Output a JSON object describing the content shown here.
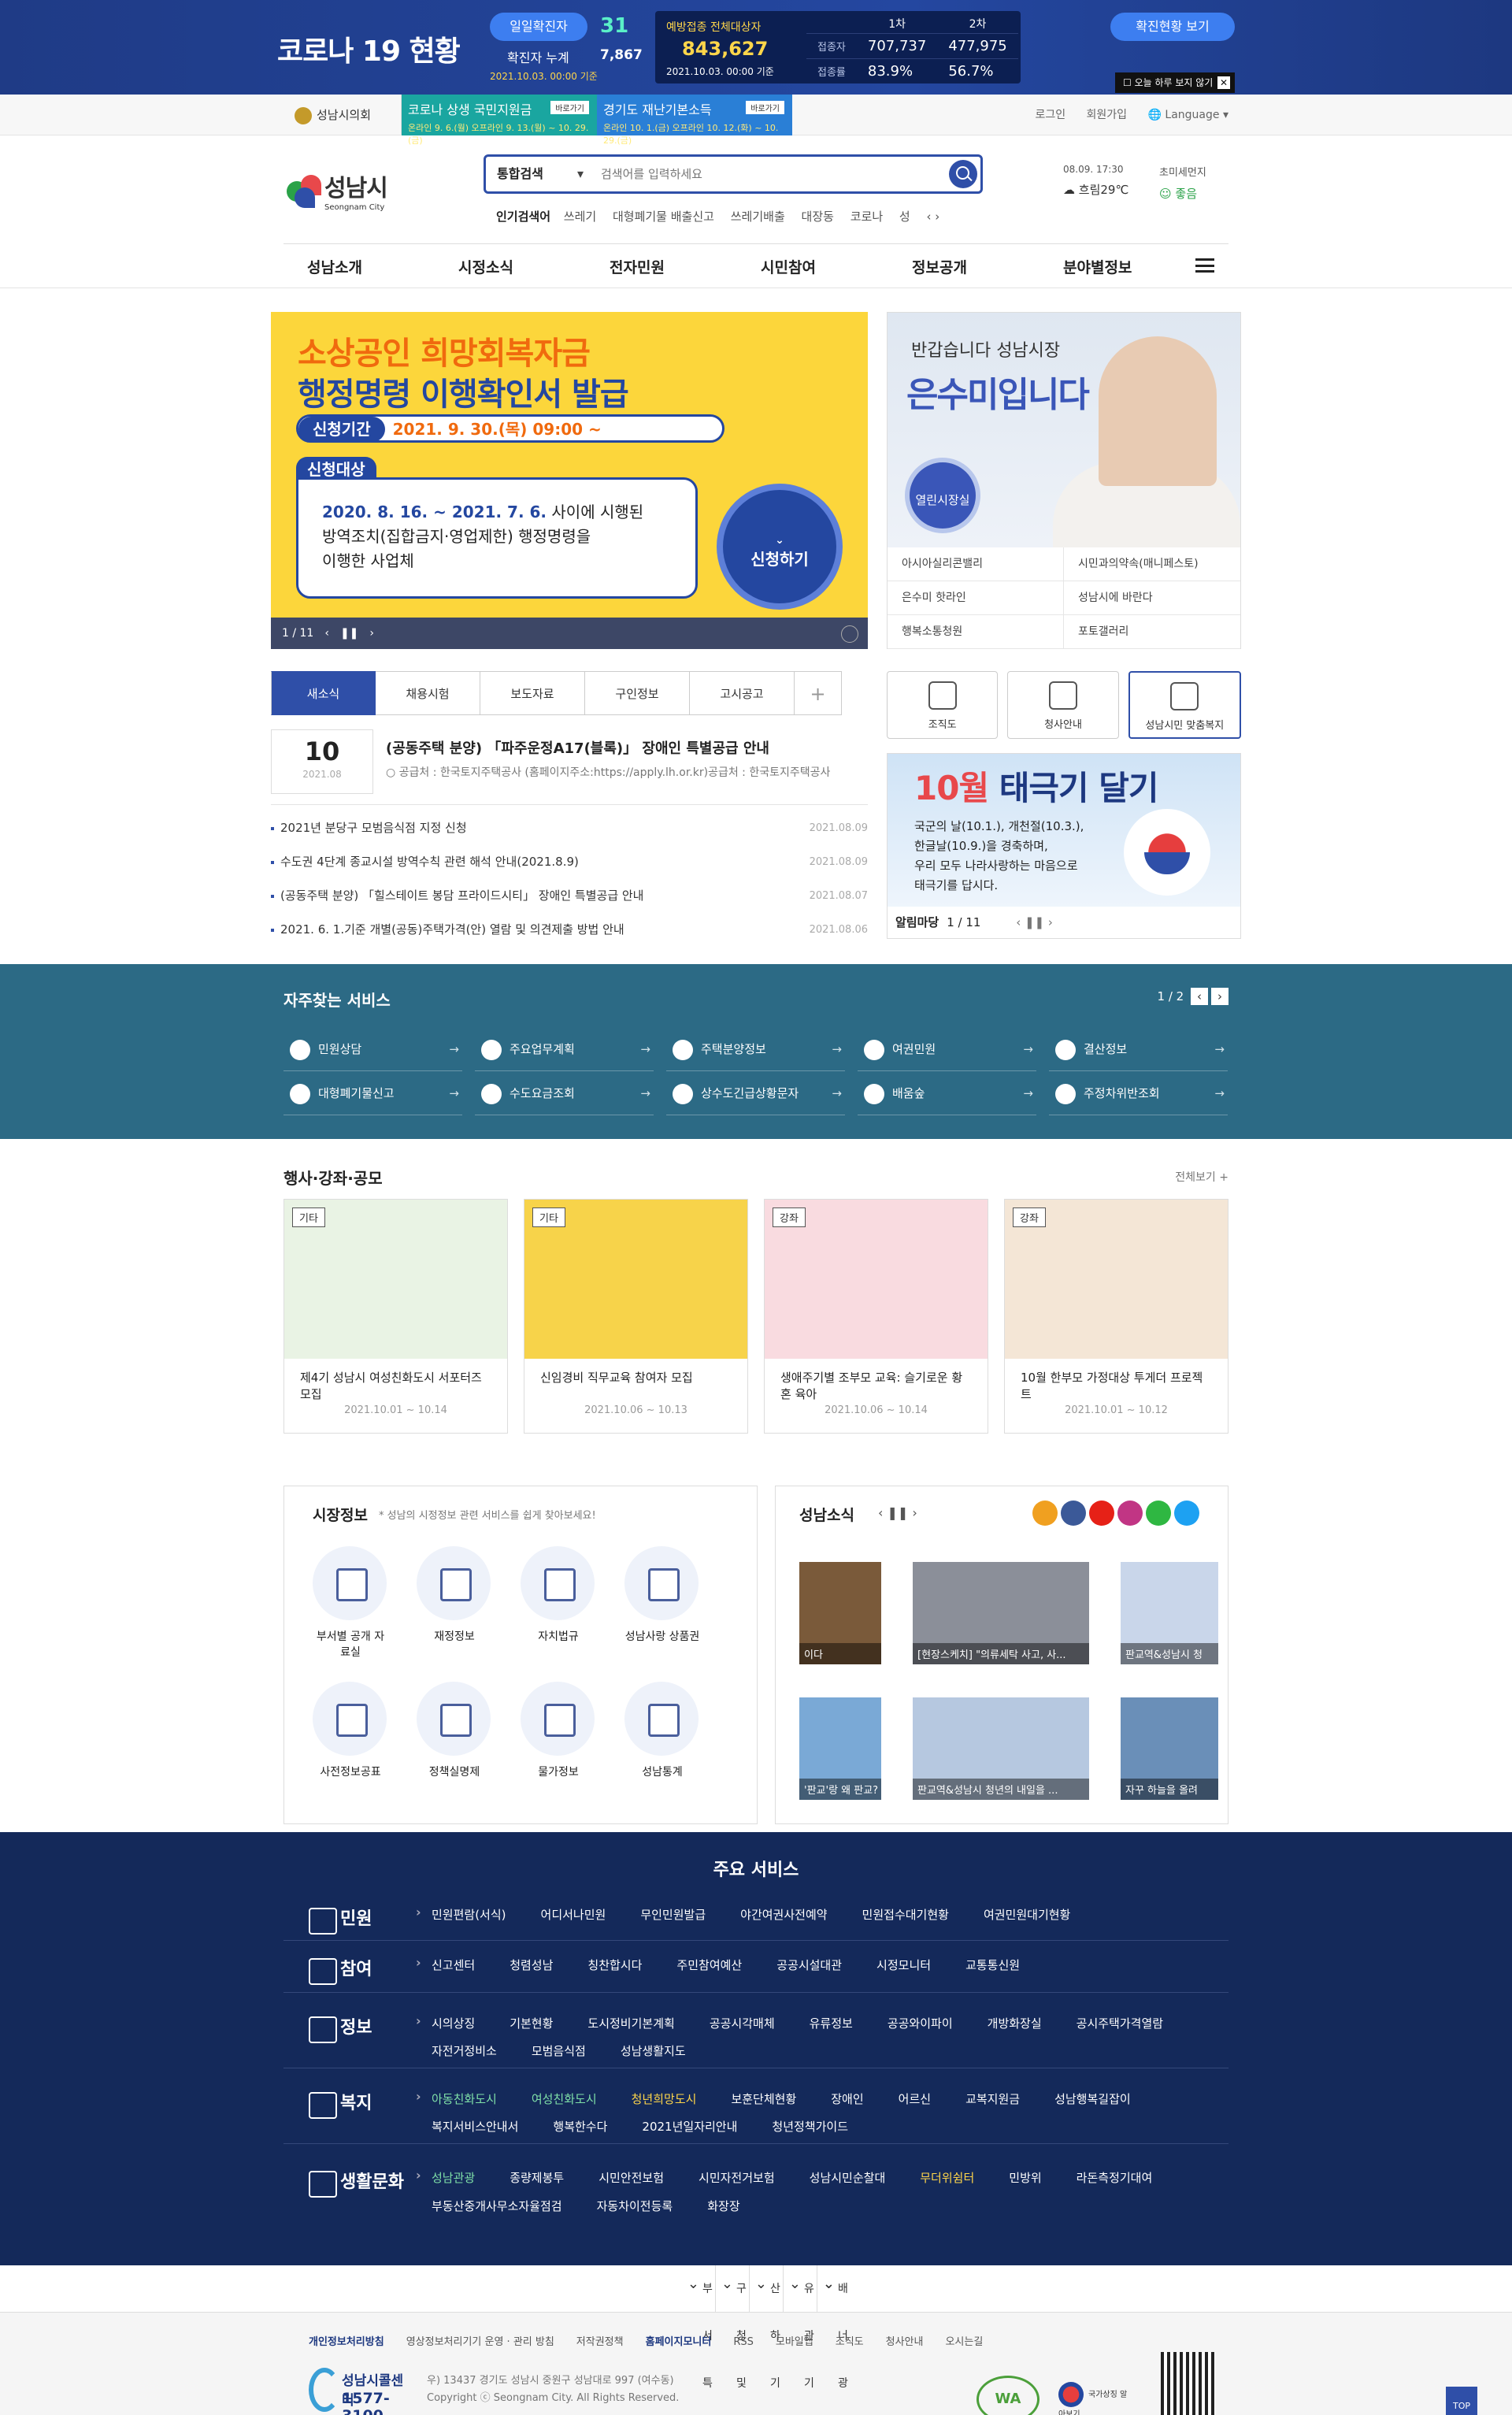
{
  "covid": {
    "title": "코로나 19 현황",
    "daily_label": "일일확진자",
    "daily_value": "31",
    "cum_label": "확진자 누계",
    "cum_value": "7,867",
    "date": "2021.10.03. 00:00 기준",
    "vac_label": "예방접종 전체대상자",
    "vac_total": "843,627",
    "vac_date": "2021.10.03. 00:00 기준",
    "vac_cols": [
      "1차",
      "2차"
    ],
    "vac_rows": [
      {
        "h": "접종자",
        "a": "707,737",
        "b": "477,975"
      },
      {
        "h": "접종률",
        "a": "83.9%",
        "b": "56.7%"
      }
    ],
    "status_btn": "확진현황 보기",
    "close_today": "오늘 하루 보지 않기"
  },
  "util": {
    "council": "성남시의회",
    "promo1_title": "코로나 상생 국민지원금",
    "promo1_sub": "온라인 9. 6.(월) 오프라인 9. 13.(월) ~ 10. 29.(금)",
    "promo1_tag": "바로가기",
    "promo2_title": "경기도 재난기본소득",
    "promo2_sub": "온라인 10. 1.(금) 오프라인 10. 12.(화) ~ 10. 29.(금)",
    "promo2_tag": "바로가기",
    "login": "로그인",
    "join": "회원가입",
    "language": "Language"
  },
  "header": {
    "logo_kr": "성남시",
    "logo_en": "Seongnam City",
    "search_cat": "통합검색",
    "search_placeholder": "검색어를 입력하세요",
    "popular_label": "인기검색어",
    "popular": [
      "쓰레기",
      "대형폐기물 배출신고",
      "쓰레기배출",
      "대장동",
      "코로나",
      "성"
    ],
    "weather_time": "08.09. 17:30",
    "weather_desc": "흐림29℃",
    "dust_label": "초미세먼지",
    "dust_value": "좋음"
  },
  "nav": [
    "성남소개",
    "시정소식",
    "전자민원",
    "시민참여",
    "정보공개",
    "분야별정보"
  ],
  "banner": {
    "title1": "소상공인 희망회복자금",
    "title2": "행정명령 이행확인서 발급",
    "period_label": "신청기간",
    "period": "2021. 9. 30.(목) 09:00 ~",
    "target_label": "신청대상",
    "target_l1a": "2020. 8. 16. ~ 2021. 7. 6.",
    "target_l1b": " 사이에 시행된",
    "target_l2": "방역조치(집합금지·영업제한) 행정명령을",
    "target_l3": "이행한 사업체",
    "apply": "신청하기",
    "pager": "1 / 11"
  },
  "mayor": {
    "hello": "반갑습니다 성남시장",
    "name": "은수미입니다",
    "open": "열린시장실",
    "links": [
      "아시아실리콘밸리",
      "시민과의약속(매니페스토)",
      "은수미 핫라인",
      "성남시에 바란다",
      "행복소통청원",
      "포토갤러리"
    ]
  },
  "news": {
    "tabs": [
      "새소식",
      "채용시험",
      "보도자료",
      "구인정보",
      "고시공고"
    ],
    "plus": "+",
    "top_day": "10",
    "top_ym": "2021.08",
    "top_title": "(공동주택 분양) 「파주운정A17(블록)」 장애인 특별공급 안내",
    "top_desc": "○ 공급처 : 한국토지주택공사 (홈페이지주소:https://apply.lh.or.kr)공급처 : 한국토지주택공사",
    "list": [
      {
        "t": "2021년 분당구 모범음식점 지정 신청",
        "d": "2021.08.09"
      },
      {
        "t": "수도권 4단계 종교시설 방역수칙 관련 해석 안내(2021.8.9)",
        "d": "2021.08.09"
      },
      {
        "t": "(공동주택 분양) 「힐스테이트 봉담 프라이드시티」 장애인 특별공급 안내",
        "d": "2021.08.07"
      },
      {
        "t": "2021. 6. 1.기준 개별(공동)주택가격(안) 열람 및 의견제출 방법 안내",
        "d": "2021.08.06"
      }
    ]
  },
  "quick3": [
    "조직도",
    "청사안내",
    "성남시민 맞춤복지"
  ],
  "flag": {
    "title_a": "10월",
    "title_b": " 태극기 달기",
    "desc": [
      "국군의 날(10.1.), 개천절(10.3.),",
      "한글날(10.9.)을 경축하며,",
      "우리 모두 나라사랑하는 마음으로",
      "태극기를 답시다."
    ],
    "bar_label": "알림마당",
    "pager": "1 / 11"
  },
  "freq": {
    "title": "자주찾는 서비스",
    "pager": "1 / 2",
    "items": [
      "민원상담",
      "주요업무계획",
      "주택분양정보",
      "여권민원",
      "결산정보",
      "대형폐기물신고",
      "수도요금조회",
      "상수도긴급상황문자",
      "배움숲",
      "주정차위반조회"
    ]
  },
  "events": {
    "title": "행사·강좌·공모",
    "more": "전체보기 +",
    "cards": [
      {
        "tag": "기타",
        "title": "제4기 성남시 여성친화도시 서포터즈 모집",
        "date": "2021.10.01 ~ 10.14",
        "bg": "#e9f3e4"
      },
      {
        "tag": "기타",
        "title": "신임경비 직무교육 참여자 모집",
        "date": "2021.10.06 ~ 10.13",
        "bg": "#f7d34a"
      },
      {
        "tag": "강좌",
        "title": "생애주기별 조부모 교육: 슬기로운 황혼 육아",
        "date": "2021.10.06 ~ 10.14",
        "bg": "#f9dbe0"
      },
      {
        "tag": "강좌",
        "title": "10월 한부모 가정대상 투게더 프로젝트",
        "date": "2021.10.01 ~ 10.12",
        "bg": "#f4e6d6"
      }
    ]
  },
  "market": {
    "title": "시장정보",
    "sub": "* 성남의 시정정보 관련 서비스를 쉽게 찾아보세요!",
    "items": [
      "부서별 공개 자료실",
      "재정정보",
      "자치법규",
      "성남사랑 상품권",
      "사전정보공표",
      "정책실명제",
      "물가정보",
      "성남통계"
    ]
  },
  "sns": {
    "title": "성남소식",
    "items": [
      "이다",
      "[현장스케치] \"의류세탁 사고, 사...",
      "판교역&성남시 청",
      "'판교'랑 왜 판교?",
      "판교역&성남시 청년의 내일을 ...",
      "자꾸 하늘을 올려"
    ]
  },
  "msvc": {
    "title": "주요 서비스",
    "rows": [
      {
        "k": "민원",
        "v": [
          "민원편람(서식)",
          "어디서나민원",
          "무인민원발급",
          "야간여권사전예약",
          "민원접수대기현황",
          "여권민원대기현황"
        ]
      },
      {
        "k": "참여",
        "v": [
          "신고센터",
          "청렴성남",
          "칭찬합시다",
          "주민참여예산",
          "공공시설대관",
          "시정모니터",
          "교통통신원"
        ]
      },
      {
        "k": "정보",
        "v": [
          "시의상징",
          "기본현황",
          "도시정비기본계획",
          "공공시각매체",
          "유류정보",
          "공공와이파이",
          "개방화장실",
          "공시주택가격열람",
          "자전거정비소",
          "모범음식점",
          "성남생활지도"
        ]
      },
      {
        "k": "복지",
        "v": [
          "아동친화도시",
          "여성친화도시",
          "청년희망도시",
          "보훈단체현황",
          "장애인",
          "어르신",
          "교복지원금",
          "성남행복길잡이",
          "복지서비스안내서",
          "행복한수다",
          "2021년일자리안내",
          "청년정책가이드"
        ]
      },
      {
        "k": "생활문화",
        "v": [
          "성남관광",
          "종량제봉투",
          "시민안전보험",
          "시민자전거보험",
          "성남시민순찰대",
          "무더위쉼터",
          "민방위",
          "라돈측정기대여",
          "부동산중개사무소자율점검",
          "자동차이전등록",
          "화장장"
        ]
      }
    ]
  },
  "flinks": [
    "부서특화홈페이지",
    "구청 및 동행정복지센터",
    "산하기관 사이트",
    "유관기관 사이트",
    "배너광장"
  ],
  "footer": {
    "menu": [
      "개인정보처리방침",
      "영상정보처리기기 운영 · 관리 방침",
      "저작권정책",
      "홈페이지모니터",
      "RSS",
      "모바일앱",
      "조직도",
      "청사안내",
      "오시는길"
    ],
    "call_name": "성남시콜센터",
    "call_num": "1577-3100",
    "addr": "우) 13437 경기도 성남시 중원구 성남대로 997 (여수동)",
    "copy": "Copyright ⓒ Seongnam City. All Rights Reserved.",
    "wa": "WA",
    "ko": "국가상징 알아보기"
  },
  "top": "TOP"
}
